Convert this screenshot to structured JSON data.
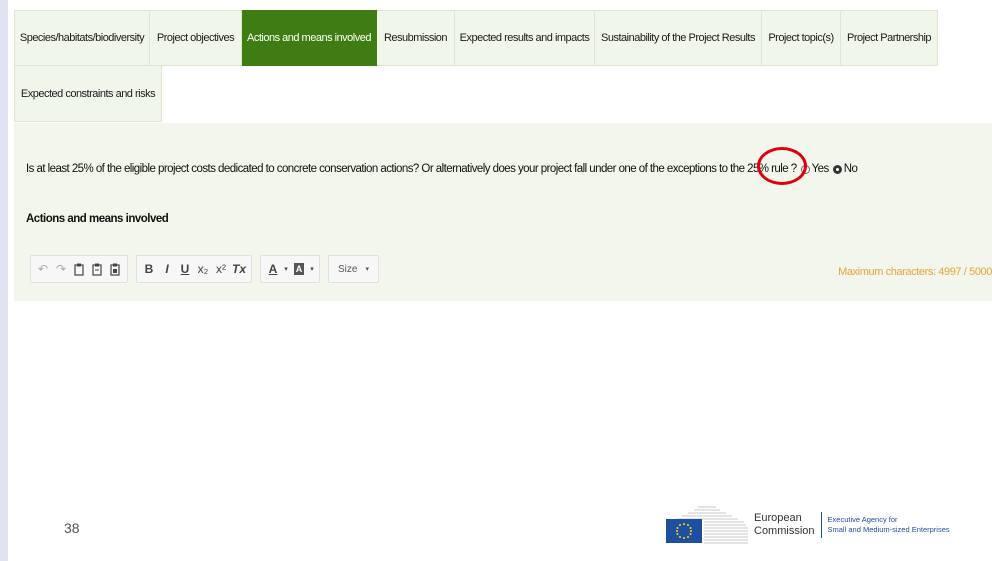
{
  "tabs": [
    {
      "label": "Species/habitats/biodiversity",
      "active": false
    },
    {
      "label": "Project objectives",
      "active": false
    },
    {
      "label": "Actions and means involved",
      "active": true
    },
    {
      "label": "Resubmission",
      "active": false
    },
    {
      "label": "Expected results and impacts",
      "active": false
    },
    {
      "label": "Sustainability of the Project Results",
      "active": false
    },
    {
      "label": "Project topic(s)",
      "active": false
    },
    {
      "label": "Project Partnership",
      "active": false
    },
    {
      "label": "Expected constraints and risks",
      "active": false
    }
  ],
  "question": {
    "text": "Is at least 25% of the eligible project costs dedicated to concrete conservation actions? Or alternatively does your project fall under one of the exceptions to the 25% rule ?",
    "yes_label": "Yes",
    "no_label": "No",
    "selected": "No"
  },
  "field": {
    "label": "Actions and means involved",
    "max_chars": "Maximum characters: 4997 / 5000"
  },
  "toolbar": {
    "undo_icon": "undo-icon",
    "redo_icon": "redo-icon",
    "paste_icon": "paste-icon",
    "paste_text_icon": "paste-text-icon",
    "paste_word_icon": "paste-word-icon",
    "bold": "B",
    "italic": "I",
    "underline": "U",
    "subscript": "x₂",
    "superscript": "x²",
    "remove_format": "Tx",
    "text_color": "A",
    "bg_color": "A",
    "size_label": "Size"
  },
  "footer": {
    "page_number": "38",
    "logo_line1": "European",
    "logo_line2": "Commission",
    "agency_line1": "Executive Agency for",
    "agency_line2": "Small and Medium-sized Enterprises"
  },
  "colors": {
    "active_tab": "#3f7d12",
    "panel_bg": "#f2f6ec",
    "highlight": "#e0000d",
    "max_chars": "#e8a33a"
  }
}
